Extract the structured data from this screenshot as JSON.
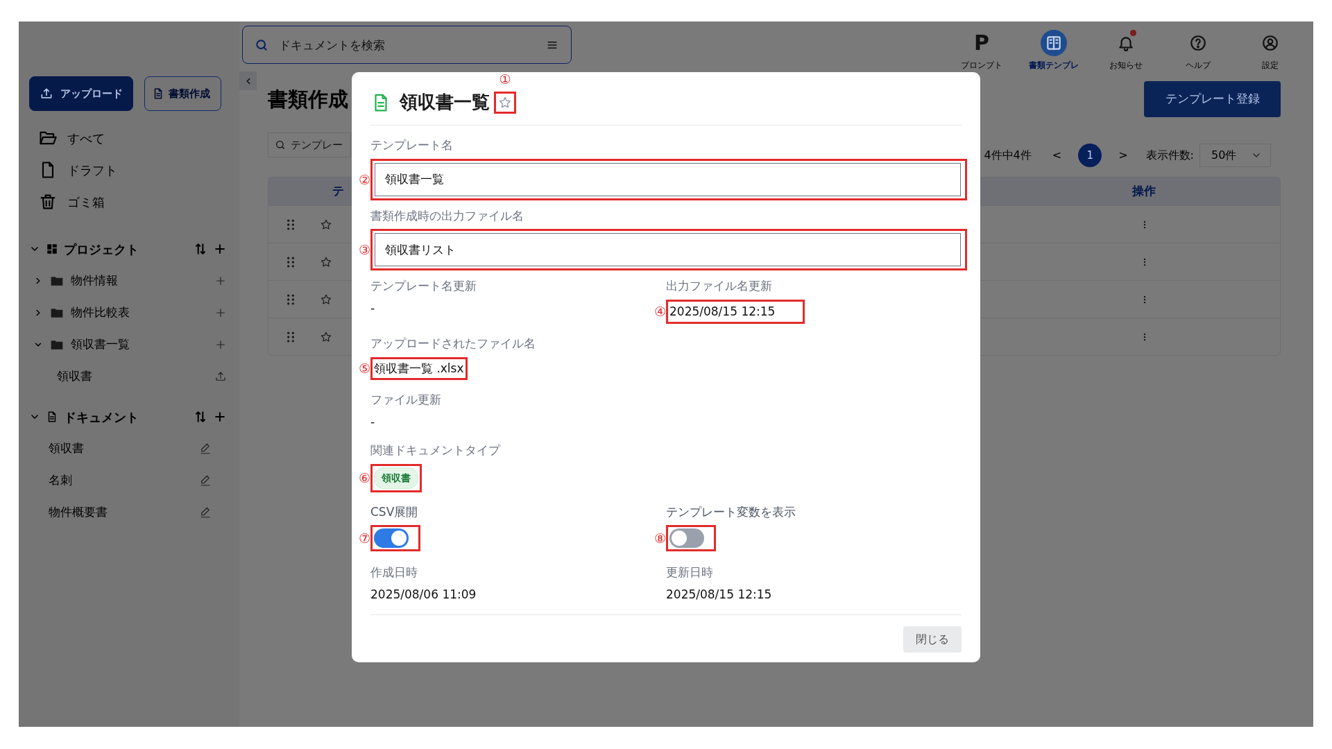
{
  "topbar": {
    "search": {
      "placeholder": "ドキュメントを検索"
    },
    "nav": [
      {
        "glyph": "P",
        "label": "プロンプト",
        "selected": false,
        "unread": false
      },
      {
        "label": "書類テンプレ",
        "selected": true,
        "unread": false
      },
      {
        "label": "お知らせ",
        "selected": false,
        "unread": true
      },
      {
        "label": "ヘルプ",
        "selected": false,
        "unread": false
      },
      {
        "label": "設定",
        "selected": false,
        "unread": false
      }
    ]
  },
  "sidebar": {
    "buttons": [
      {
        "label": "アップロード",
        "kind": "primary"
      },
      {
        "label": "書類作成",
        "kind": "outline"
      }
    ],
    "items": [
      {
        "label": "すべて"
      },
      {
        "label": "ドラフト"
      },
      {
        "label": "ゴミ箱"
      }
    ],
    "sections": [
      {
        "title": "プロジェクト",
        "kind": "project",
        "expanded": true,
        "children": [
          {
            "label": "物件情報",
            "kind": "folder",
            "expanded": false
          },
          {
            "label": "物件比較表",
            "kind": "folder",
            "expanded": false
          },
          {
            "label": "領収書一覧",
            "kind": "folder",
            "expanded": true,
            "children": [
              {
                "label": "領収書",
                "kind": "template"
              }
            ]
          }
        ]
      },
      {
        "title": "ドキュメント",
        "kind": "document",
        "expanded": true,
        "children": [
          {
            "label": "領収書",
            "kind": "document"
          },
          {
            "label": "名刺",
            "kind": "document"
          },
          {
            "label": "物件概要書",
            "kind": "document"
          }
        ]
      }
    ]
  },
  "main": {
    "title": "書類作成",
    "register_button": "テンプレート登録",
    "search": {
      "placeholder": "テンプレー"
    },
    "pagination": {
      "summary": "4件中4件",
      "prev": "<",
      "pages": [
        {
          "label": "1",
          "selected": true
        }
      ],
      "next": ">",
      "page_size_label": "表示件数:",
      "page_size": "50件"
    },
    "table": {
      "columns": [
        "テ",
        "操作"
      ],
      "rows": [
        {
          "starred": false
        },
        {
          "starred": false
        },
        {
          "starred": false
        },
        {
          "starred": false
        }
      ]
    }
  },
  "modal": {
    "title": "領収書一覧",
    "starred": false,
    "star_annotation": "①",
    "rows": [
      [
        {
          "kind": "input",
          "label": "テンプレート名",
          "value": "領収書一覧",
          "annotation": "②"
        }
      ],
      [
        {
          "kind": "input",
          "label": "書類作成時の出力ファイル名",
          "value": "領収書リスト",
          "annotation": "③"
        }
      ],
      [
        {
          "kind": "text",
          "label": "テンプレート名更新",
          "value": "-"
        },
        {
          "kind": "text",
          "label": "出力ファイル名更新",
          "value": "2025/08/15 12:15",
          "annotation": "④"
        }
      ],
      [
        {
          "kind": "text",
          "label": "アップロードされたファイル名",
          "value": "領収書一覧 .xlsx",
          "annotation": "⑤"
        }
      ],
      [
        {
          "kind": "text",
          "label": "ファイル更新",
          "value": "-"
        }
      ],
      [
        {
          "kind": "tags",
          "label": "関連ドキュメントタイプ",
          "tags": [
            {
              "label": "領収書"
            }
          ],
          "annotation": "⑥"
        }
      ],
      [
        {
          "kind": "switch",
          "label": "CSV展開",
          "on": true,
          "annotation": "⑦"
        },
        {
          "kind": "switch",
          "label": "テンプレート変数を表示",
          "on": false,
          "annotation": "⑧"
        }
      ],
      [
        {
          "kind": "text",
          "label": "作成日時",
          "value": "2025/08/06 11:09"
        },
        {
          "kind": "text",
          "label": "更新日時",
          "value": "2025/08/15 12:15"
        }
      ]
    ],
    "close_button": "閉じる"
  }
}
